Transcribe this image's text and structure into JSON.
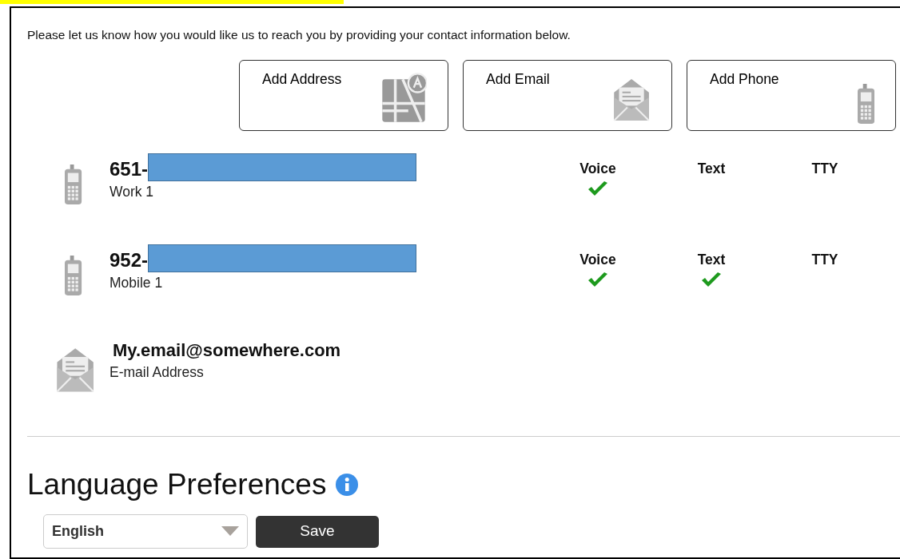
{
  "intro": "Please let us know how you would like us to reach you by providing your contact information below.",
  "add_buttons": [
    {
      "label": "Add Address",
      "kind": "map"
    },
    {
      "label": "Add Email",
      "kind": "email"
    },
    {
      "label": "Add Phone",
      "kind": "phone"
    }
  ],
  "contacts": [
    {
      "kind": "phone",
      "value": "651-",
      "label": "Work 1",
      "redacted": true,
      "channels": [
        {
          "label": "Voice",
          "checked": true
        },
        {
          "label": "Text",
          "checked": false
        },
        {
          "label": "TTY",
          "checked": false
        }
      ]
    },
    {
      "kind": "phone",
      "value": "952-",
      "label": "Mobile 1",
      "redacted": true,
      "channels": [
        {
          "label": "Voice",
          "checked": true
        },
        {
          "label": "Text",
          "checked": true
        },
        {
          "label": "TTY",
          "checked": false
        }
      ]
    },
    {
      "kind": "email",
      "value": "My.email@somewhere.com",
      "label": "E-mail Address"
    }
  ],
  "language": {
    "title": "Language Preferences",
    "value": "English",
    "button": "Save"
  }
}
